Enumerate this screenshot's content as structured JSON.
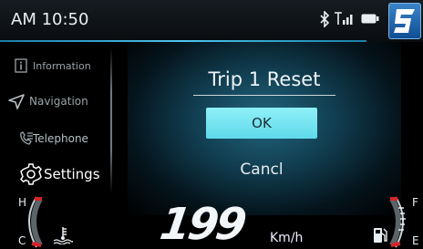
{
  "status_bar": {
    "time": "AM 10:50",
    "icons": [
      "bluetooth-icon",
      "signal-icon",
      "battery-icon",
      "logo-icon"
    ]
  },
  "sidebar": {
    "items": [
      {
        "label": "Information",
        "icon": "info-icon"
      },
      {
        "label": "Navigation",
        "icon": "navigation-icon"
      },
      {
        "label": "Telephone",
        "icon": "telephone-icon"
      },
      {
        "label": "Settings",
        "icon": "gear-icon"
      }
    ]
  },
  "dialog": {
    "title": "Trip 1 Reset",
    "ok_label": "OK",
    "cancel_label": "Cancl"
  },
  "dashboard": {
    "speed": "199",
    "speed_unit": "Km/h",
    "temp_high_label": "H",
    "temp_low_label": "C",
    "fuel_full_label": "F",
    "fuel_empty_label": "E"
  },
  "colors": {
    "accent": "#4fc6ee",
    "button": "#6ee3f0",
    "warning": "#d6242b",
    "logo": "#1e5fa8"
  }
}
